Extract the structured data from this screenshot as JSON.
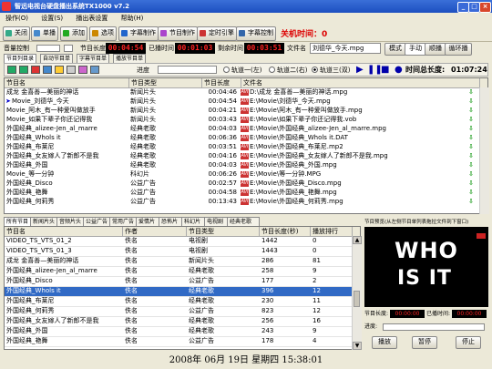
{
  "window": {
    "title": "智远电视台硬盘播出系统TX1000 v7.2",
    "min": "_",
    "max": "□",
    "close": "×"
  },
  "menu": [
    "操作(O)",
    "设置(S)",
    "播出表设置",
    "帮助(H)"
  ],
  "toolbar": {
    "close": "关闭",
    "single": "单播",
    "add": "添加",
    "select": "选项",
    "subtitle_make": "字幕制作",
    "program_make": "节目制作",
    "timed_capture": "定时引擎",
    "subtitle_control": "字幕控制",
    "relay_status": "关机时间：0"
  },
  "status_row": {
    "volume_label": "音量控制",
    "program_length_label": "节目长度",
    "program_length": "00:04:54",
    "played_label": "已播时间",
    "played": "00:01:03",
    "remaining_label": "剩余时间",
    "remaining": "00:03:51",
    "filename_label": "文件名",
    "filename": "刘德华_今天.mpg",
    "mode_buttons": [
      "模式",
      "手动",
      "顺播",
      "循环播"
    ]
  },
  "top_tabs": [
    "节目列目录",
    "自动节目单",
    "字幕节目单",
    "播放节目单"
  ],
  "controls": {
    "progress_label": "进度",
    "radio_options": [
      "轨道一(左)",
      "轨道二(右)",
      "轨道三(双)"
    ],
    "total_label": "时间总长度:",
    "total": "01:07:24"
  },
  "playlist": {
    "columns": [
      "节目名",
      "节目类型",
      "节目长度",
      "文件名"
    ],
    "rows": [
      {
        "name": "成龙 金喜善—美丽的神话",
        "type": "新闻片头",
        "len": "00:04:46",
        "file": "D:\\成龙 金喜善—美丽的神话.mpg"
      },
      {
        "name": "Movie_刘德华_今天",
        "type": "新闻片头",
        "len": "00:04:54",
        "file": "E:\\Movie\\刘德华_今天.mpg"
      },
      {
        "name": "Movie_阿木_有一种爱叫做放手",
        "type": "新闻片头",
        "len": "00:04:21",
        "file": "E:\\Movie\\阿木_有一种爱叫做放手.mpg"
      },
      {
        "name": "Movie_如果下辈子你还记得我",
        "type": "新闻片头",
        "len": "00:03:43",
        "file": "E:\\Movie\\如果下辈子你还记得我.vob"
      },
      {
        "name": "外国经典_alizee-Jen_al_marre",
        "type": "经典老歌",
        "len": "00:04:03",
        "file": "E:\\Movie\\外国经典_alizee-Jen_al_marre.mpg"
      },
      {
        "name": "外国经典_Whols it",
        "type": "经典老歌",
        "len": "00:06:36",
        "file": "E:\\Movie\\外国经典_Whols it.DAT"
      },
      {
        "name": "外国经典_布莱尼",
        "type": "经典老歌",
        "len": "00:03:51",
        "file": "E:\\Movie\\外国经典_布莱尼.mp2"
      },
      {
        "name": "外国经典_女友嫁人了新郎不是我",
        "type": "经典老歌",
        "len": "00:04:16",
        "file": "E:\\Movie\\外国经典_女友嫁人了新郎不是我.mpg"
      },
      {
        "name": "外国经典_外国",
        "type": "经典老歌",
        "len": "00:04:03",
        "file": "E:\\Movie\\外国经典_外国.mpg"
      },
      {
        "name": "Movie_等一分钟",
        "type": "科幻片",
        "len": "00:06:26",
        "file": "E:\\Movie\\等一分钟.MPG"
      },
      {
        "name": "外国经典_Disco",
        "type": "公益广告",
        "len": "00:02:57",
        "file": "E:\\Movie\\外国经典_Disco.mpg"
      },
      {
        "name": "外国经典_艳舞",
        "type": "公益广告",
        "len": "00:04:58",
        "file": "E:\\Movie\\外国经典_艳舞.mpg"
      },
      {
        "name": "外国经典_何莉秀",
        "type": "公益广告",
        "len": "00:13:43",
        "file": "E:\\Movie\\外国经典_何莉秀.mpg"
      }
    ]
  },
  "bottom_tabs": [
    "所有节目",
    "新闻片头",
    "音频片头",
    "公益广告",
    "常用广告",
    "爱情片",
    "恐怖片",
    "科幻片",
    "电视剧",
    "经典老歌"
  ],
  "library": {
    "columns": [
      "节目名",
      "作者",
      "节目类型",
      "节目长度(秒)",
      "播放排行"
    ],
    "rows": [
      {
        "name": "VIDEO_TS_VTS_01_2",
        "author": "佚名",
        "type": "电视剧",
        "len": "1442",
        "rank": "0"
      },
      {
        "name": "VIDEO_TS_VTS_01_3",
        "author": "佚名",
        "type": "电视剧",
        "len": "1443",
        "rank": "0"
      },
      {
        "name": "成龙 金喜善—美丽的神话",
        "author": "佚名",
        "type": "新闻片头",
        "len": "286",
        "rank": "81"
      },
      {
        "name": "外国经典_alizee-Jen_al_marre",
        "author": "佚名",
        "type": "经典老歌",
        "len": "258",
        "rank": "9"
      },
      {
        "name": "外国经典_Disco",
        "author": "佚名",
        "type": "公益广告",
        "len": "177",
        "rank": "2"
      },
      {
        "name": "外国经典_Whols it",
        "author": "佚名",
        "type": "经典老歌",
        "len": "396",
        "rank": "12"
      },
      {
        "name": "外国经典_布莱尼",
        "author": "佚名",
        "type": "经典老歌",
        "len": "230",
        "rank": "11"
      },
      {
        "name": "外国经典_何莉秀",
        "author": "佚名",
        "type": "公益广告",
        "len": "823",
        "rank": "12"
      },
      {
        "name": "外国经典_女友嫁人了新郎不是我",
        "author": "佚名",
        "type": "经典老歌",
        "len": "256",
        "rank": "16"
      },
      {
        "name": "外国经典_外国",
        "author": "佚名",
        "type": "经典老歌",
        "len": "243",
        "rank": "9"
      },
      {
        "name": "外国经典_艳舞",
        "author": "佚名",
        "type": "公益广告",
        "len": "178",
        "rank": "4"
      }
    ]
  },
  "preview": {
    "header": "节目预览(从左侧节目单列表拖拉文件到下窗口)",
    "overlay_top": "WHO",
    "overlay_bottom": "IS IT",
    "program_length_label": "节目长度:",
    "played_label": "已播时间:",
    "program_length": "00:00:00",
    "played": "00:00:00",
    "progress_label": "进度:",
    "buttons": [
      "播放",
      "暂停",
      "停止"
    ]
  },
  "datetime": "2008年  06月  19日  星期四  15:38:01"
}
